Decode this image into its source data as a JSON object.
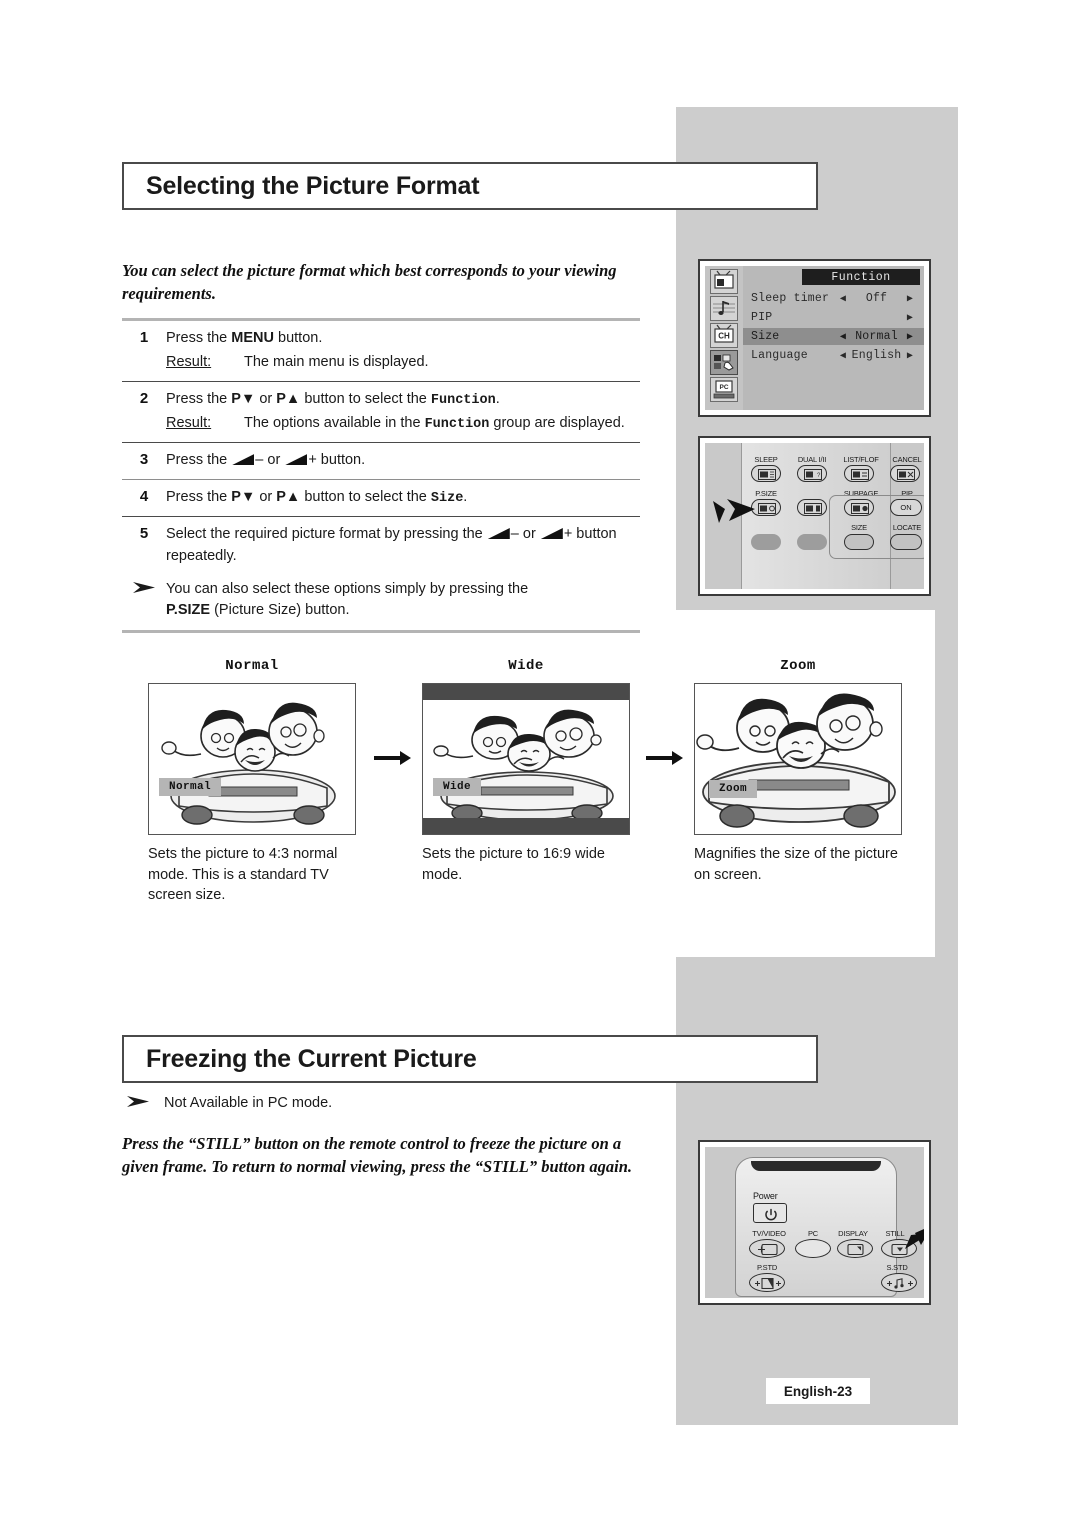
{
  "sections": {
    "picture_format": {
      "heading": "Selecting the Picture Format",
      "intro": "You can select the picture format which best corresponds to your viewing requirements.",
      "steps": [
        {
          "num": "1",
          "text_before": "Press the ",
          "bold": "MENU",
          "text_after": " button.",
          "result_label": "Result:",
          "result_text": "The main menu is displayed."
        },
        {
          "num": "2",
          "text_before": "Press the ",
          "bold": "P▼",
          "mid": " or ",
          "bold2": "P▲",
          "text_after": " button to select the ",
          "mono": "Function",
          "tail": ".",
          "result_label": "Result:",
          "result_pre": "The options available in the ",
          "result_mono": "Function",
          "result_post": " group are displayed."
        },
        {
          "num": "3",
          "text_before": "Press the ",
          "minus": "–",
          "mid": " or ",
          "plus": "+",
          "text_after": " button."
        },
        {
          "num": "4",
          "text_before": "Press the ",
          "bold": "P▼",
          "mid": " or ",
          "bold2": "P▲",
          "text_after": " button to select the ",
          "mono": "Size",
          "tail": "."
        },
        {
          "num": "5",
          "text_before": "Select the required picture format by pressing the ",
          "minus": "–",
          "mid": " or ",
          "plus": "+",
          "text_after": " button repeatedly."
        }
      ],
      "note": {
        "line1": "You can also select these options simply by pressing the ",
        "bold": "P.SIZE",
        "line2": " (Picture Size) button."
      }
    },
    "freeze": {
      "heading": "Freezing the Current Picture",
      "note": "Not Available in PC mode.",
      "body": "Press the “STILL” button on the remote control to freeze the picture on a given frame. To return to normal viewing, press the “STILL” button again."
    }
  },
  "osd": {
    "title": "Function",
    "rows": [
      {
        "label": "Sleep timer",
        "left_arrow": "◀",
        "value": "Off",
        "right_arrow": "▶",
        "highlighted": false
      },
      {
        "label": "PIP",
        "left_arrow": "",
        "value": "",
        "right_arrow": "▶",
        "highlighted": false
      },
      {
        "label": "Size",
        "left_arrow": "◀",
        "value": "Normal",
        "right_arrow": "▶",
        "highlighted": true
      },
      {
        "label": "Language",
        "left_arrow": "◀",
        "value": "English",
        "right_arrow": "▶",
        "highlighted": false
      }
    ],
    "icons": [
      "picture-icon",
      "sound-icon",
      "channel-icon",
      "function-icon",
      "pc-icon"
    ],
    "icon_labels": {
      "channel": "CH",
      "pc": "PC"
    }
  },
  "remote_top": {
    "buttons": [
      {
        "label": "SLEEP",
        "name": "sleep-button"
      },
      {
        "label": "DUAL I/II",
        "name": "dual-button"
      },
      {
        "label": "LIST/FLOF",
        "name": "list-flof-button"
      },
      {
        "label": "CANCEL",
        "name": "cancel-button"
      },
      {
        "label": "P.SIZE",
        "name": "psize-button"
      },
      {
        "label": "SUBPAGE",
        "name": "subpage-button"
      },
      {
        "label": "PIP",
        "name": "pip-button"
      },
      {
        "label": "ON",
        "name": "pip-on-button"
      },
      {
        "label": "SIZE",
        "name": "size-button"
      },
      {
        "label": "LOCATE",
        "name": "locate-button"
      }
    ]
  },
  "remote_bottom": {
    "buttons": [
      {
        "label": "Power",
        "name": "power-button"
      },
      {
        "label": "TV/VIDEO",
        "name": "tv-video-button"
      },
      {
        "label": "PC",
        "name": "pc-button"
      },
      {
        "label": "DISPLAY",
        "name": "display-button"
      },
      {
        "label": "STILL",
        "name": "still-button"
      },
      {
        "label": "P.STD",
        "name": "pstd-button"
      },
      {
        "label": "S.STD",
        "name": "sstd-button"
      }
    ]
  },
  "examples": [
    {
      "title": "Normal",
      "badge": "Normal",
      "caption": "Sets the picture to 4:3 normal mode. This is a standard TV screen size.",
      "letterbox": false
    },
    {
      "title": "Wide",
      "badge": "Wide",
      "caption": "Sets the picture to 16:9 wide mode.",
      "letterbox": true
    },
    {
      "title": "Zoom",
      "badge": "Zoom",
      "caption": "Magnifies the size of the picture on screen.",
      "letterbox": false
    }
  ],
  "footer": {
    "page": "English-23"
  }
}
